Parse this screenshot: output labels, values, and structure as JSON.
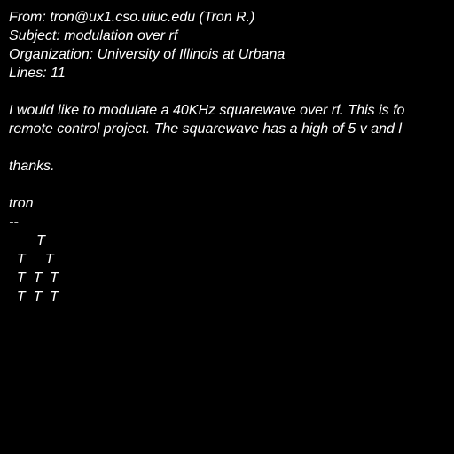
{
  "header": {
    "from": "From: tron@ux1.cso.uiuc.edu (Tron R.)",
    "subject": "Subject: modulation over rf",
    "organization": "Organization: University of Illinois at Urbana",
    "lines": "Lines: 11"
  },
  "body": {
    "paragraph_line1": "I would like to modulate a 40KHz squarewave over rf. This is fo",
    "paragraph_line2": "remote control project. The squarewave has a high of 5 v and l",
    "closing": "thanks.",
    "signature_name": "tron",
    "signature_separator": "--",
    "art": [
      "       T",
      "  T     T",
      "  T  T  T",
      "  T  T  T"
    ]
  },
  "colors": {
    "background": "#000000",
    "text": "#ffffff"
  }
}
